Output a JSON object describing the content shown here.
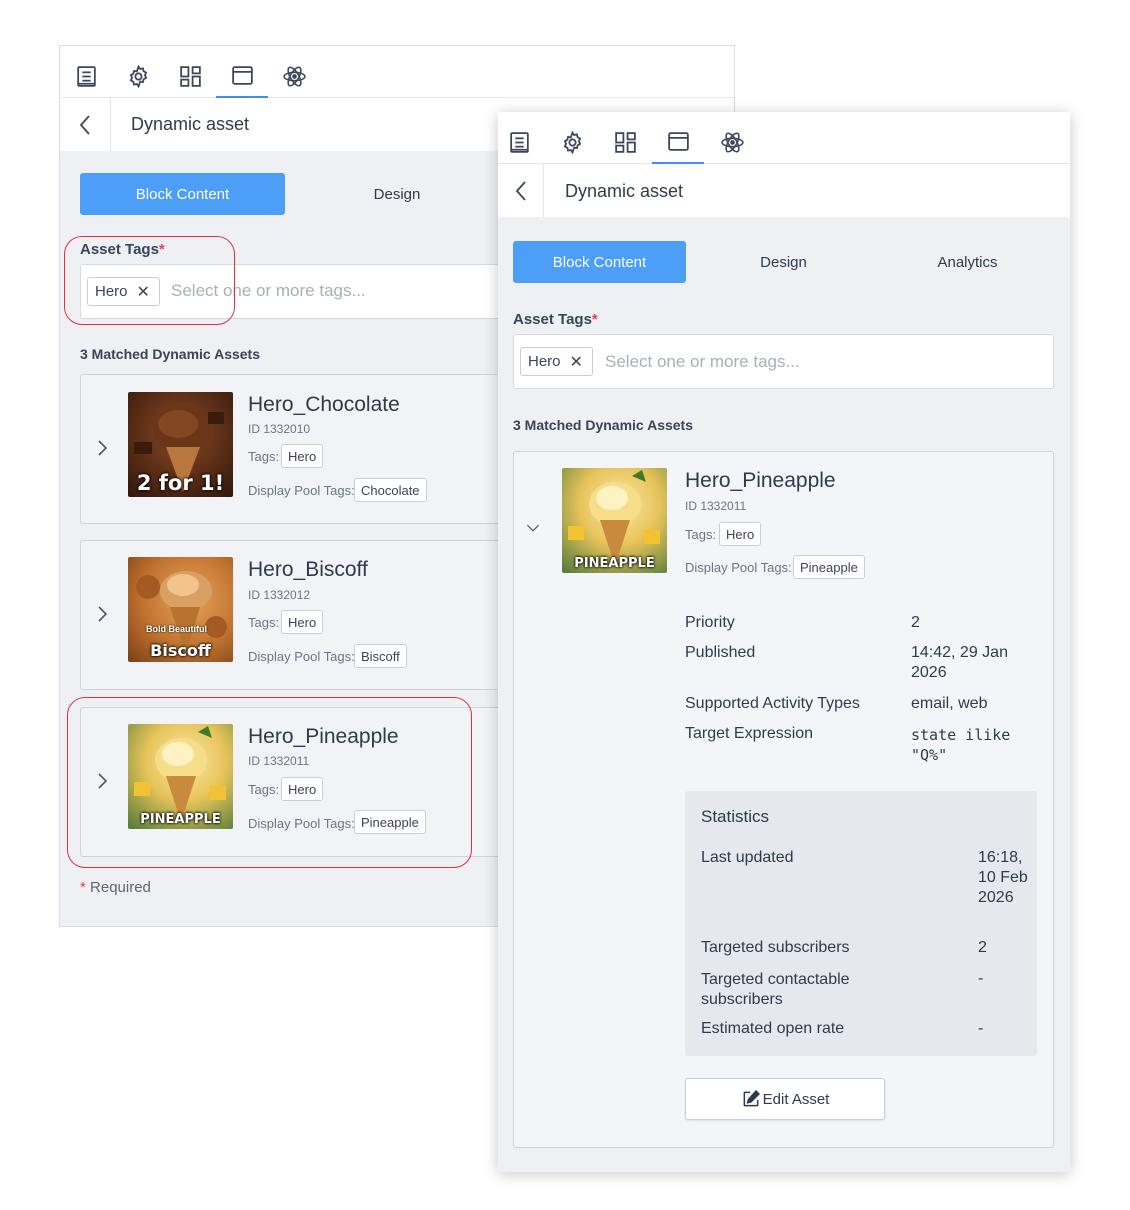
{
  "toolbar": {
    "icons": [
      "document-icon",
      "gear-icon",
      "layout-icon",
      "window-icon",
      "atom-icon"
    ],
    "active_index": 3
  },
  "header": {
    "title": "Dynamic asset"
  },
  "tabs": [
    {
      "label": "Block Content",
      "active": true
    },
    {
      "label": "Design",
      "active": false
    },
    {
      "label": "Analytics",
      "active": false
    }
  ],
  "asset_tags": {
    "label": "Asset Tags",
    "required_mark": "*",
    "chip": "Hero",
    "placeholder": "Select one or more tags..."
  },
  "matched": {
    "title": "3 Matched Dynamic Assets"
  },
  "assets": [
    {
      "name": "Hero_Chocolate",
      "id": "ID 1332010",
      "tags_label": "Tags:",
      "tag": "Hero",
      "pool_label": "Display Pool Tags:",
      "pool_tag": "Chocolate",
      "thumb_text": "2 for 1!"
    },
    {
      "name": "Hero_Biscoff",
      "id": "ID 1332012",
      "tags_label": "Tags:",
      "tag": "Hero",
      "pool_label": "Display Pool Tags:",
      "pool_tag": "Biscoff",
      "thumb_text": "Biscoff",
      "thumb_subtext": "Bold Beautiful"
    },
    {
      "name": "Hero_Pineapple",
      "id": "ID 1332011",
      "tags_label": "Tags:",
      "tag": "Hero",
      "pool_label": "Display Pool Tags:",
      "pool_tag": "Pineapple",
      "thumb_text": "PINEAPPLE"
    }
  ],
  "required_note": {
    "star": "*",
    "text": "Required"
  },
  "details": {
    "priority_label": "Priority",
    "priority_value": "2",
    "published_label": "Published",
    "published_value": "14:42, 29 Jan 2026",
    "activity_label": "Supported Activity Types",
    "activity_value": "email, web",
    "target_label": "Target Expression",
    "target_value": "state ilike \"Q%\""
  },
  "statistics": {
    "title": "Statistics",
    "last_updated_label": "Last updated",
    "last_updated_value": "16:18, 10 Feb 2026",
    "subscribers_label": "Targeted subscribers",
    "subscribers_value": "2",
    "contactable_label": "Targeted contactable subscribers",
    "contactable_value": "-",
    "open_rate_label": "Estimated open rate",
    "open_rate_value": "-"
  },
  "edit_button": {
    "label": "Edit Asset"
  },
  "colors": {
    "accent": "#4c9ef7",
    "highlight": "#e0323c",
    "panel_bg": "#eef0f4"
  }
}
